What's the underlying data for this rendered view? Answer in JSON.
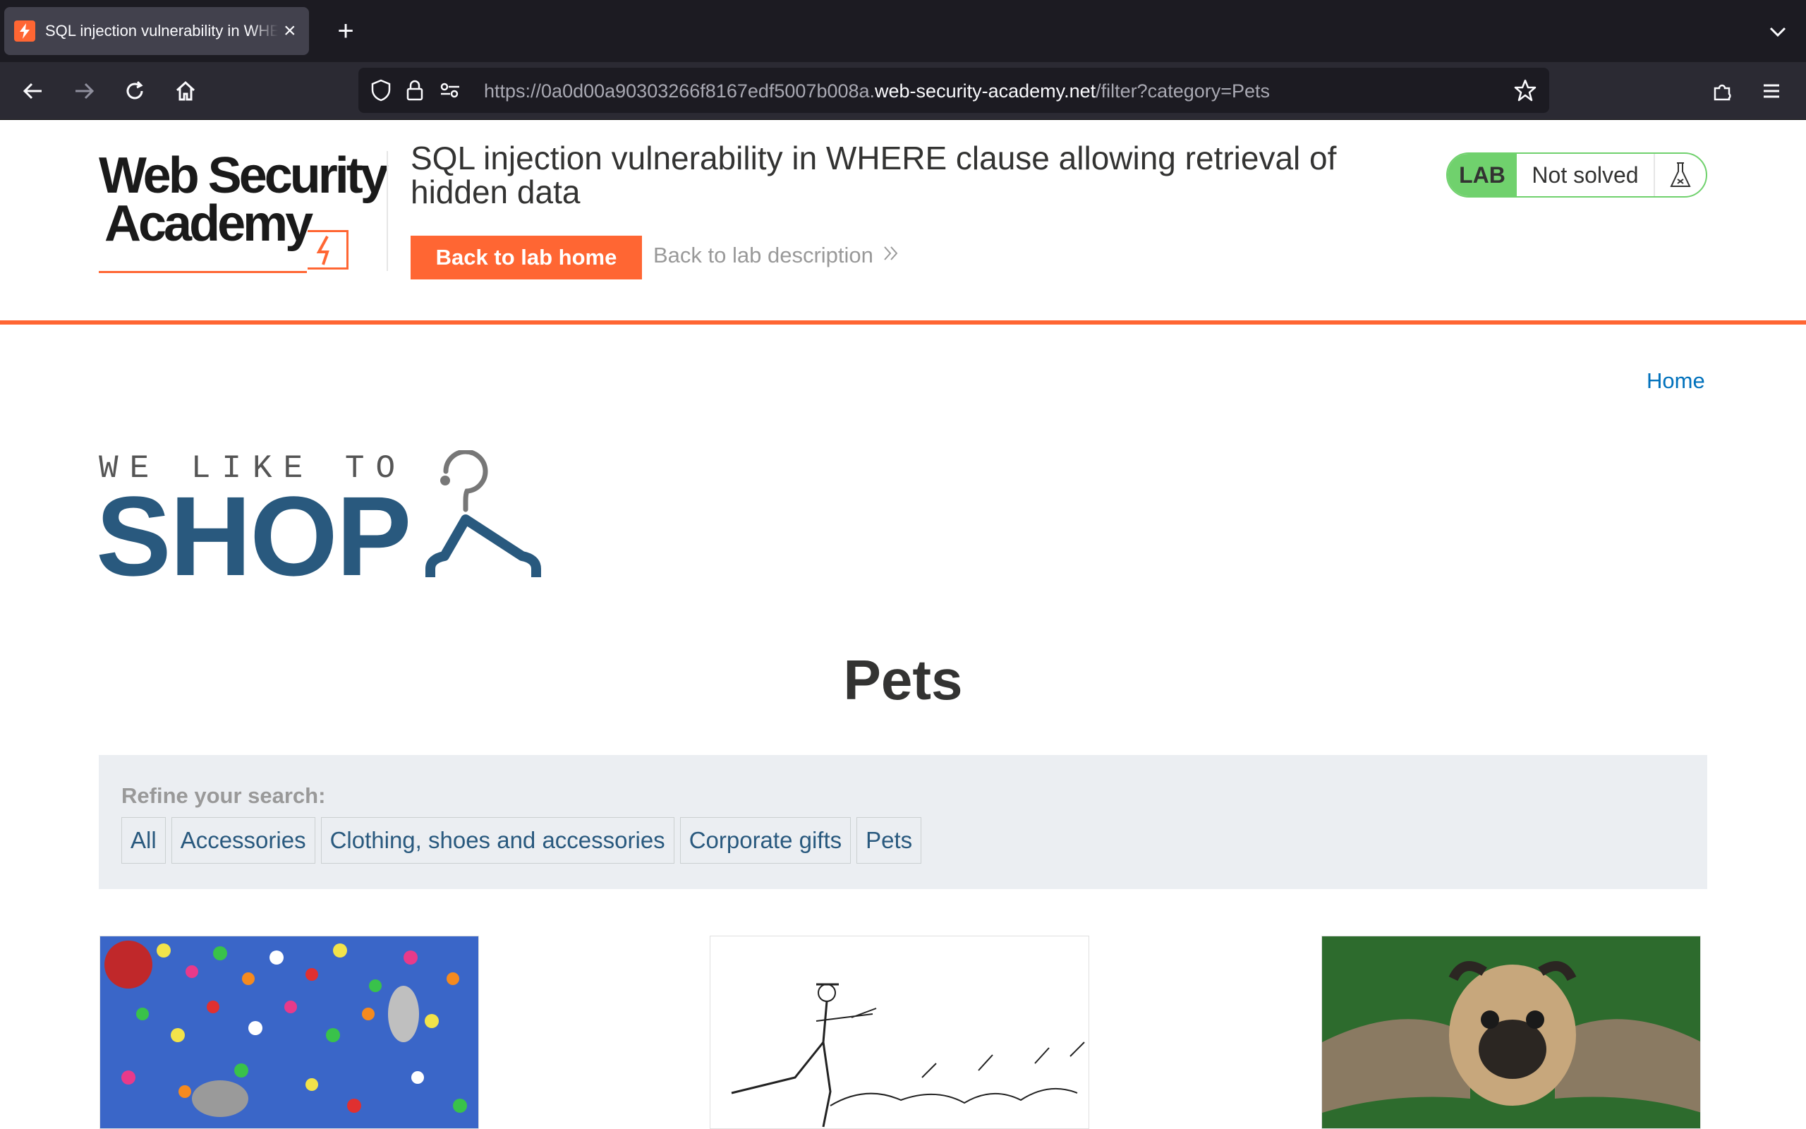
{
  "browser": {
    "tab_title": "SQL injection vulnerability in WHERE clause allowing retrieval of hidden data",
    "tab_close": "×",
    "new_tab": "+",
    "url_prefix": "https://0a0d00a90303266f8167edf5007b008a.",
    "url_domain": "web-security-academy.net",
    "url_path": "/filter?category=Pets"
  },
  "academy": {
    "logo_line1": "Web Security",
    "logo_line2": "Academy",
    "lab_title": "SQL injection vulnerability in WHERE clause allowing retrieval of hidden data",
    "back_home_label": "Back to lab home",
    "back_description_label": "Back to lab description",
    "status_tag": "LAB",
    "status_text": "Not solved",
    "accent_color": "#ff6633",
    "status_color": "#70d16d"
  },
  "shop": {
    "home_link": "Home",
    "logo_tagline": "WE LIKE TO",
    "logo_word": "SHOP",
    "category_heading": "Pets",
    "filter_label": "Refine your search:",
    "filters": [
      "All",
      "Accessories",
      "Clothing, shoes and accessories",
      "Corporate gifts",
      "Pets"
    ],
    "brand_color": "#29597e"
  }
}
